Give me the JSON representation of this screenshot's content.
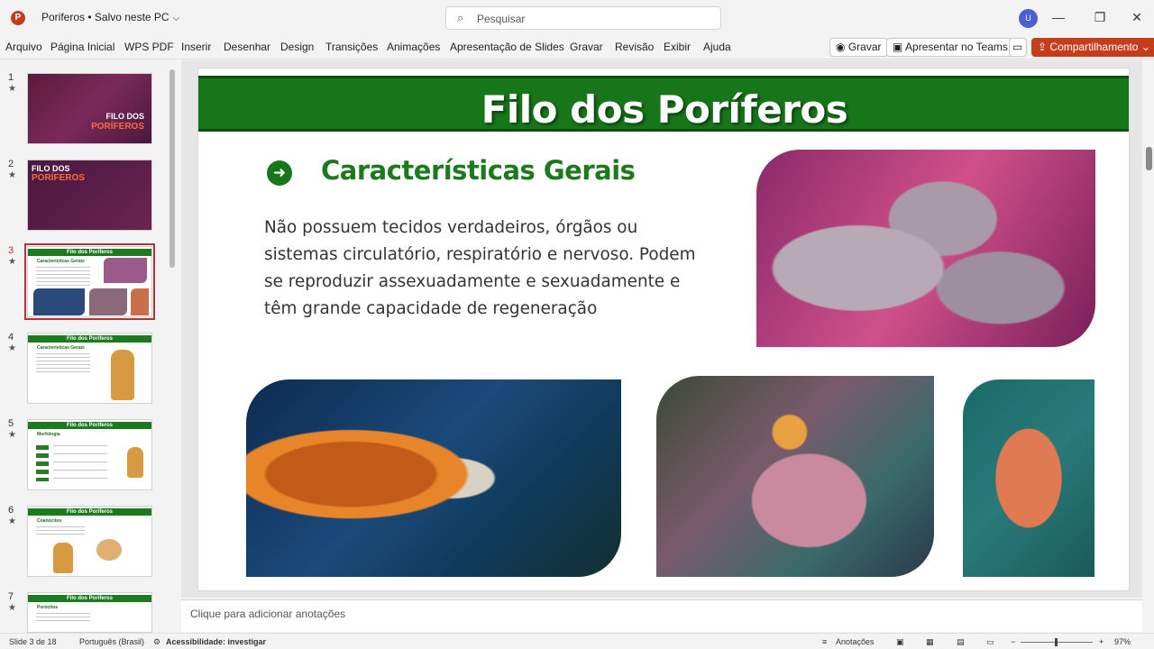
{
  "titlebar": {
    "app_icon_letter": "P",
    "doc_title": "Poriferos • Salvo neste PC",
    "search_placeholder": "Pesquisar",
    "avatar_initial": "U",
    "minimize": "—",
    "restore": "❐",
    "close": "✕"
  },
  "menu": {
    "items": [
      "Arquivo",
      "Página Inicial",
      "WPS PDF",
      "Inserir",
      "Desenhar",
      "Design",
      "Transições",
      "Animações",
      "Apresentação de Slides",
      "Gravar",
      "Revisão",
      "Exibir",
      "Ajuda"
    ],
    "record_label": "Gravar",
    "teams_label": "Apresentar no Teams",
    "share_label": "Compartilhamento"
  },
  "thumbnails": {
    "numbers": [
      "1",
      "2",
      "3",
      "4",
      "5",
      "6",
      "7"
    ],
    "star": "★",
    "slide1": {
      "line1": "FILO DOS",
      "line2": "PORÍFEROS"
    },
    "slide2": {
      "line1": "FILO DOS",
      "line2": "PORÍFEROS"
    },
    "green_title": "Filo dos Poríferos",
    "subs": [
      "Características Gerais",
      "Características Gerais",
      "Morfologia",
      "Coanócitos",
      "Porócitos"
    ]
  },
  "slide": {
    "title": "Filo dos Poríferos",
    "subtitle": "Características Gerais",
    "body": "Não possuem tecidos verdadeiros, órgãos ou sistemas circulatório, respiratório e nervoso. Podem se reproduzir assexuadamente e sexuadamente e têm grande capacidade de regeneração"
  },
  "notes": {
    "placeholder": "Clique para adicionar anotações"
  },
  "status": {
    "slide_counter": "Slide 3 de 18",
    "language": "Português (Brasil)",
    "accessibility": "Acessibilidade: investigar",
    "notes_btn": "Anotações",
    "zoom": "97%"
  },
  "colors": {
    "accent_green": "#17761a",
    "share_red": "#c43e1c"
  }
}
